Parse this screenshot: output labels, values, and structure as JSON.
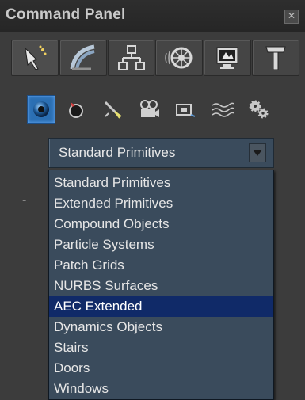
{
  "window": {
    "title": "Command Panel",
    "close_icon": "close-x"
  },
  "main_tabs": [
    {
      "name": "create-tab",
      "icon": "create-arrow-icon",
      "active": true
    },
    {
      "name": "modify-tab",
      "icon": "modify-rainbow-icon",
      "active": false
    },
    {
      "name": "hierarchy-tab",
      "icon": "hierarchy-icon",
      "active": false
    },
    {
      "name": "motion-tab",
      "icon": "motion-wheel-icon",
      "active": false
    },
    {
      "name": "display-tab",
      "icon": "display-monitor-icon",
      "active": false
    },
    {
      "name": "utilities-tab",
      "icon": "hammer-icon",
      "active": false
    }
  ],
  "categories": [
    {
      "name": "geometry",
      "icon": "sphere-icon",
      "active": true
    },
    {
      "name": "shapes",
      "icon": "shapes-icon",
      "active": false
    },
    {
      "name": "lights",
      "icon": "light-icon",
      "active": false
    },
    {
      "name": "cameras",
      "icon": "camera-icon",
      "active": false
    },
    {
      "name": "helpers",
      "icon": "helper-icon",
      "active": false
    },
    {
      "name": "space-warps",
      "icon": "wave-icon",
      "active": false
    },
    {
      "name": "systems",
      "icon": "gears-icon",
      "active": false
    }
  ],
  "dropdown": {
    "selected_value": "Standard Primitives",
    "highlighted": "AEC Extended",
    "options": [
      "Standard Primitives",
      "Extended Primitives",
      "Compound Objects",
      "Particle Systems",
      "Patch Grids",
      "NURBS Surfaces",
      "AEC Extended",
      "Dynamics Objects",
      "Stairs",
      "Doors",
      "Windows"
    ]
  },
  "rollout": {
    "collapse_symbol": "-"
  },
  "colors": {
    "panel_bg": "#3c3c3c",
    "dropdown_bg": "#3a4b5c",
    "highlight": "#102a68",
    "active_category": "#2b6fb3"
  }
}
